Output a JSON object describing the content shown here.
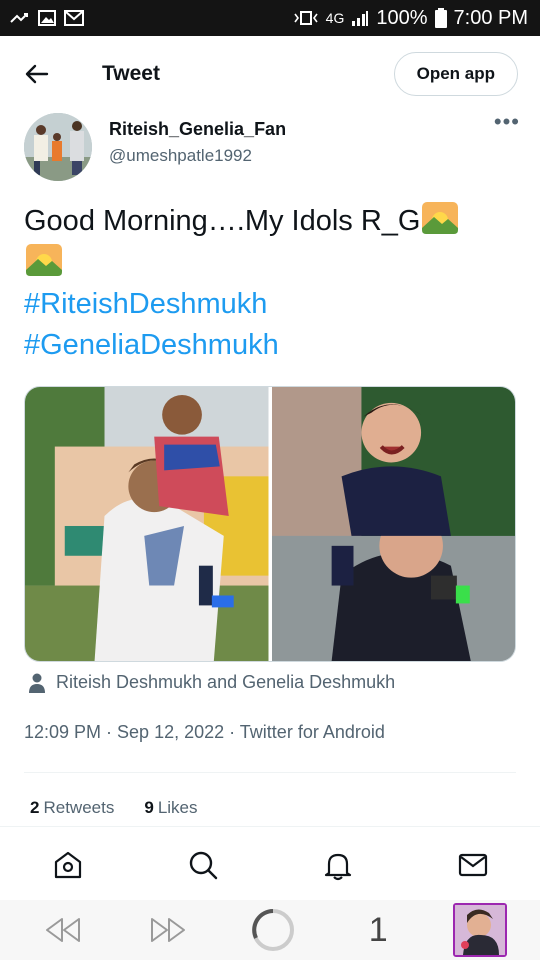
{
  "status_bar": {
    "signal_label": "4G",
    "battery": "100%",
    "time": "7:00 PM"
  },
  "header": {
    "title": "Tweet",
    "open_app_label": "Open app"
  },
  "author": {
    "name": "Riteish_Genelia_Fan",
    "handle": "@umeshpatle1992"
  },
  "tweet": {
    "text": "Good Morning….My Idols R_G",
    "hashtags": [
      "#RiteishDeshmukh",
      "#GeneliaDeshmukh"
    ],
    "tagged_people": "Riteish Deshmukh and Genelia Deshmukh",
    "meta": "12:09 PM · Sep 12, 2022 · Twitter for Android"
  },
  "stats": {
    "retweets_count": "2",
    "retweets_label": "Retweets",
    "likes_count": "9",
    "likes_label": "Likes"
  },
  "browser": {
    "tab_count": "1"
  },
  "colors": {
    "accent": "#1d9bf0",
    "secondary_text": "#536471",
    "status_bar_bg": "#141414",
    "profile_border": "#9c27b0"
  }
}
